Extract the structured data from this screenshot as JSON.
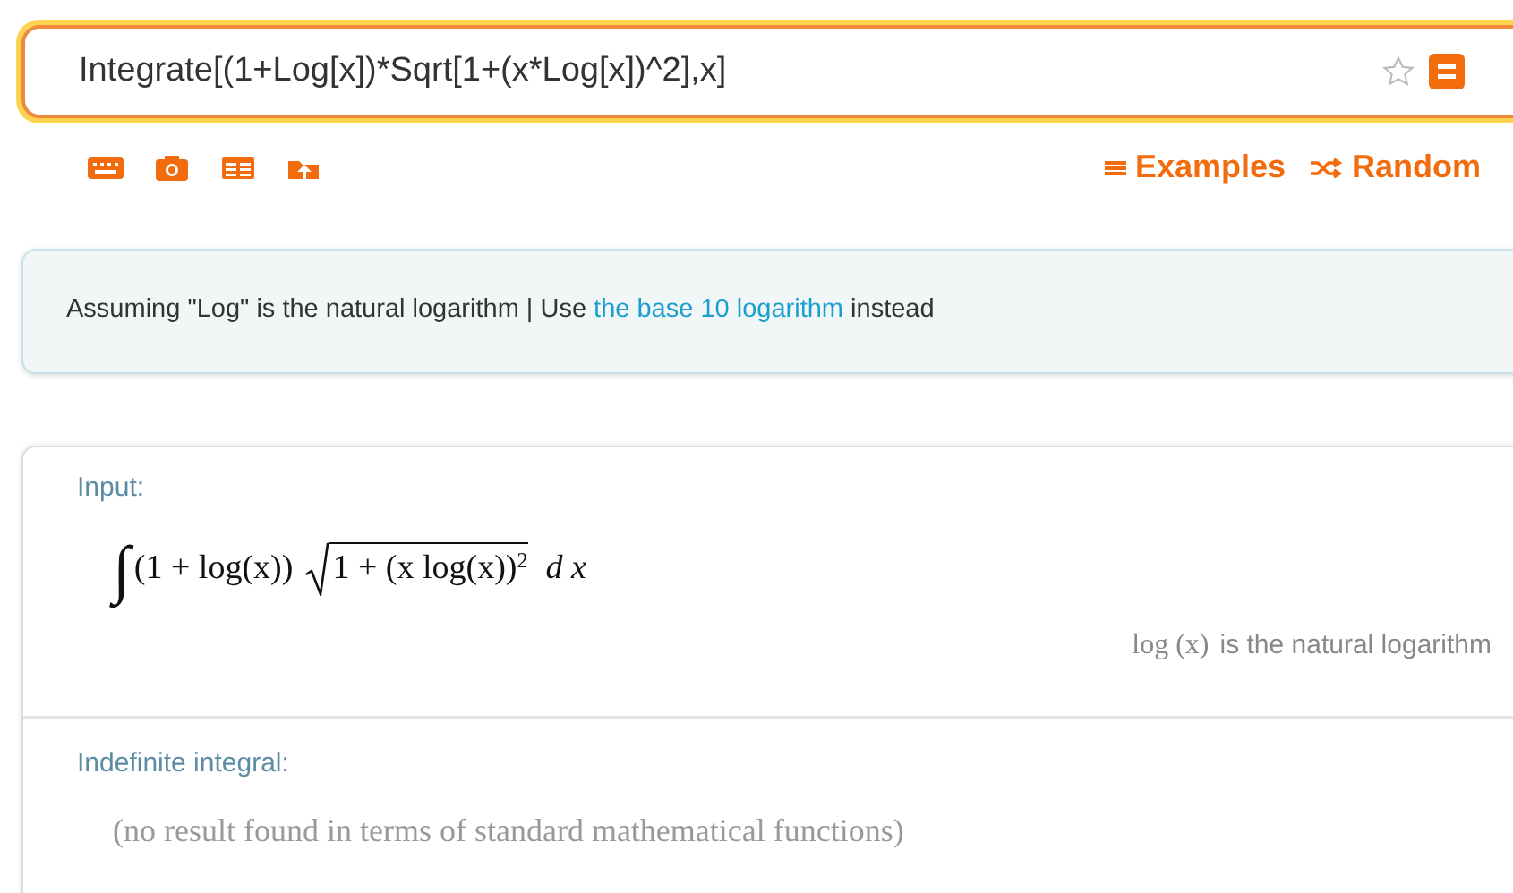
{
  "search": {
    "value": "Integrate[(1+Log[x])*Sqrt[1+(x*Log[x])^2],x]"
  },
  "toolbar": {
    "tools": [
      {
        "kind": "keyboard"
      },
      {
        "kind": "camera"
      },
      {
        "kind": "table"
      },
      {
        "kind": "upload"
      }
    ],
    "links": [
      {
        "kind": "examples",
        "label": "Examples"
      },
      {
        "kind": "random",
        "label": "Random"
      }
    ]
  },
  "assumption": {
    "text": "Assuming \"Log\" is the natural logarithm | Use",
    "link": "the base 10 logarithm",
    "after": "instead"
  },
  "pods": [
    {
      "title": "Input:",
      "kind": "formula",
      "integral": "∫",
      "factor": "(1 + log(x))",
      "radicand": "1 + (x log(x))",
      "exponent": "2",
      "differential": "d x",
      "note_math": "log (x)",
      "note_text": "is the natural logarithm"
    },
    {
      "title": "Indefinite integral:",
      "kind": "result",
      "text": "(no result found in terms of standard mathematical functions)"
    }
  ]
}
